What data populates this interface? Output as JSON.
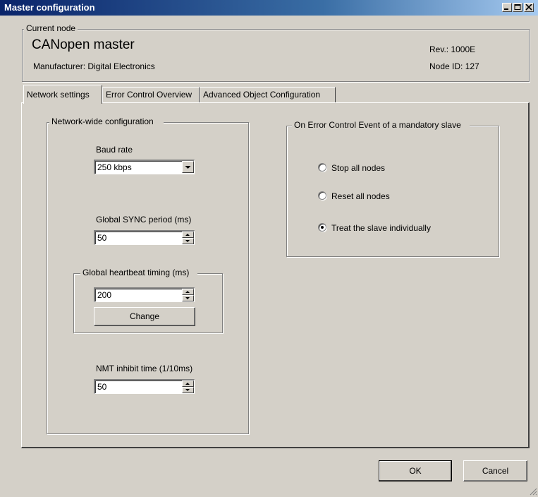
{
  "window": {
    "title": "Master configuration"
  },
  "current_node": {
    "group_label": "Current node",
    "name": "CANopen master",
    "manufacturer": "Manufacturer: Digital Electronics",
    "revision": "Rev.: 1000E",
    "node_id": "Node ID: 127"
  },
  "tabs": [
    {
      "label": "Network settings",
      "active": true
    },
    {
      "label": "Error Control Overview",
      "active": false
    },
    {
      "label": "Advanced Object Configuration",
      "active": false
    }
  ],
  "network": {
    "group_label": "Network-wide configuration",
    "baud_rate_label": "Baud rate",
    "baud_rate_value": "250 kbps",
    "sync_label": "Global SYNC period (ms)",
    "sync_value": "50",
    "heartbeat_group_label": "Global heartbeat timing (ms)",
    "heartbeat_value": "200",
    "change_label": "Change",
    "nmt_label": "NMT inhibit time (1/10ms)",
    "nmt_value": "50"
  },
  "error_event": {
    "group_label": "On Error Control Event of a mandatory slave",
    "options": [
      {
        "label": "Stop all nodes",
        "selected": false
      },
      {
        "label": "Reset all nodes",
        "selected": false
      },
      {
        "label": "Treat the slave individually",
        "selected": true
      }
    ]
  },
  "buttons": {
    "ok": "OK",
    "cancel": "Cancel"
  },
  "icons": [
    "minimize-icon",
    "maximize-icon",
    "close-icon",
    "dropdown-arrow-icon",
    "spin-up-icon",
    "spin-down-icon",
    "resize-grip-icon"
  ]
}
